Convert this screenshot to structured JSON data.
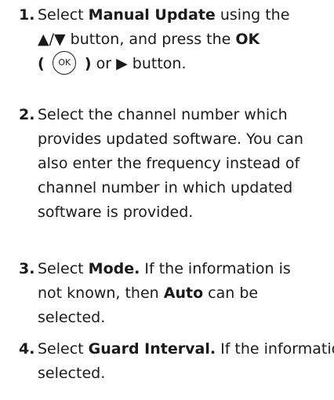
{
  "steps": [
    {
      "number": "1.",
      "l1_pre": "Select ",
      "l1_bold": "Manual Update",
      "l1_post": " using the",
      "l2_pre": "▲/▼ button, and press the ",
      "l2_bold": "OK",
      "l3_open": "( ",
      "ok_icon": "OK",
      "l3_close": " )",
      "l3_post": " or ▶ button."
    },
    {
      "number": "2.",
      "lines": [
        "Select the channel number which",
        "provides updated software. You can",
        "also enter the frequency instead of",
        "channel number in which updated",
        "software is provided."
      ]
    },
    {
      "number": "3.",
      "l1_pre": "Select ",
      "l1_bold": "Mode.",
      "l1_post": " If the information is",
      "l2_pre": "not known, then ",
      "l2_bold": "Auto",
      "l2_post": " can be",
      "l3": "selected."
    },
    {
      "number": "4.",
      "l1_pre": "Select ",
      "l1_bold": "Guard Interval.",
      "l1_post": " If the information is not known, then Auto can be",
      "l2": "selected."
    }
  ]
}
